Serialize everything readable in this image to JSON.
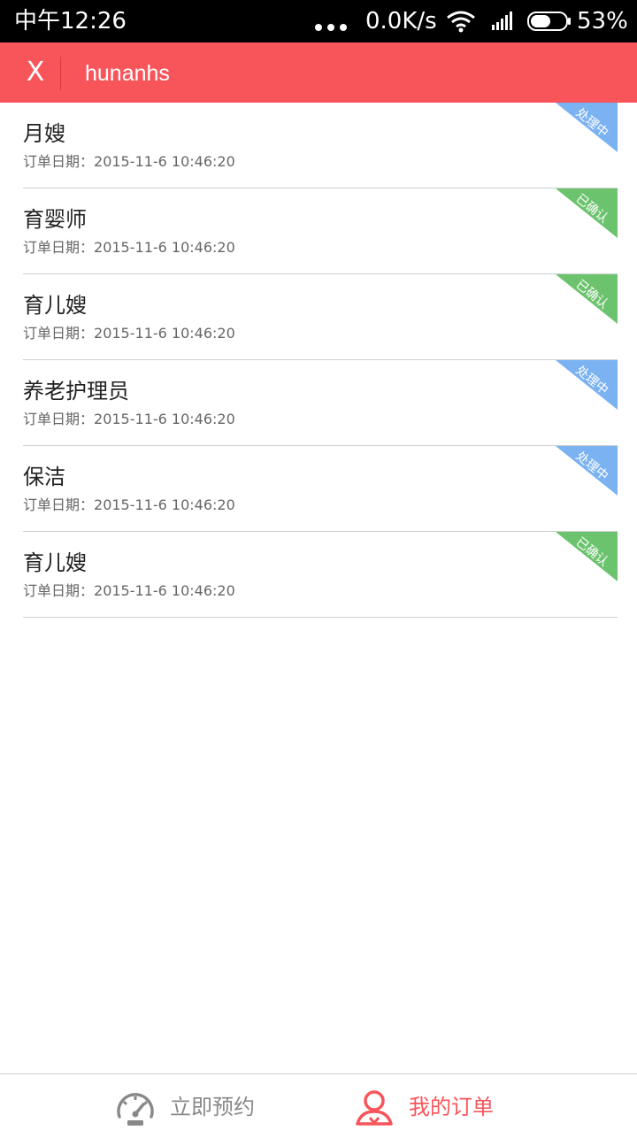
{
  "status_bar": {
    "time": "中午12:26",
    "net_speed": "0.0K/s",
    "battery": "53%",
    "icons": [
      "dots-icon",
      "wifi-icon",
      "signal-icon",
      "battery-icon"
    ]
  },
  "header": {
    "close_label": "X",
    "title": "hunanhs",
    "bg_color": "#f8555b"
  },
  "orders": [
    {
      "name": "月嫂",
      "date_label": "订单日期：",
      "date": "2015-11-6 10:46:20",
      "status": "处理中",
      "status_color": "blue"
    },
    {
      "name": "育婴师",
      "date_label": "订单日期：",
      "date": "2015-11-6 10:46:20",
      "status": "已确认",
      "status_color": "green"
    },
    {
      "name": "育儿嫂",
      "date_label": "订单日期：",
      "date": "2015-11-6 10:46:20",
      "status": "已确认",
      "status_color": "green"
    },
    {
      "name": "养老护理员",
      "date_label": "订单日期：",
      "date": "2015-11-6 10:46:20",
      "status": "处理中",
      "status_color": "blue"
    },
    {
      "name": "保洁",
      "date_label": "订单日期：",
      "date": "2015-11-6 10:46:20",
      "status": "处理中",
      "status_color": "blue"
    },
    {
      "name": "育儿嫂",
      "date_label": "订单日期：",
      "date": "2015-11-6 10:46:20",
      "status": "已确认",
      "status_color": "green"
    }
  ],
  "status_colors": {
    "processing": "#7ab2f2",
    "confirmed": "#6cc36e"
  },
  "bottom_nav": {
    "book_label": "立即预约",
    "orders_label": "我的订单",
    "active": "orders",
    "active_color": "#f8555b",
    "inactive_color": "#888888"
  }
}
